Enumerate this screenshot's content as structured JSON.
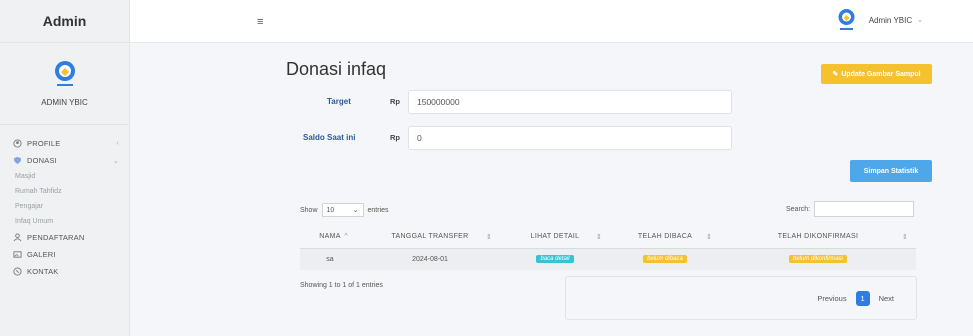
{
  "brand": "Admin",
  "user": {
    "name": "ADMIN YBIC",
    "top_name": "Admin YBIC"
  },
  "menu": {
    "profile": "PROFILE",
    "donasi": "DONASI",
    "donasi_sub": [
      "Masjid",
      "Rumah Tahfidz",
      "Pengajar",
      "Infaq Umum"
    ],
    "pendaftaran": "PENDAFTARAN",
    "galeri": "GALERI",
    "kontak": "KONTAK"
  },
  "page": {
    "title": "Donasi infaq",
    "update_button": "Update Gambar Sampul",
    "update_icon": "pencil-icon"
  },
  "form": {
    "target_label": "Target",
    "target_currency": "Rp",
    "target_value": "150000000",
    "saldo_label": "Saldo Saat ini",
    "saldo_currency": "Rp",
    "saldo_value": "0",
    "save_button": "Simpan Statistik"
  },
  "table": {
    "show_label": "Show",
    "entries_value": "10",
    "entries_label": "entries",
    "search_label": "Search:",
    "columns": [
      "NAMA",
      "TANGGAL TRANSFER",
      "LIHAT DETAIL",
      "TELAH DIBACA",
      "TELAH DIKONFIRMASI"
    ],
    "rows": [
      {
        "nama": "sa",
        "tanggal": "2024-08-01",
        "detail": "baca detail",
        "dibaca": "belum dibaca",
        "konfirmasi": "belum dikonfirmasi"
      }
    ],
    "info": "Showing 1 to 1 of 1 entries",
    "pager": {
      "previous": "Previous",
      "current": "1",
      "next": "Next"
    }
  },
  "colors": {
    "primary": "#2f7de1",
    "warning": "#f6c12e",
    "info": "#37c2d6",
    "save": "#4ea7e8"
  }
}
